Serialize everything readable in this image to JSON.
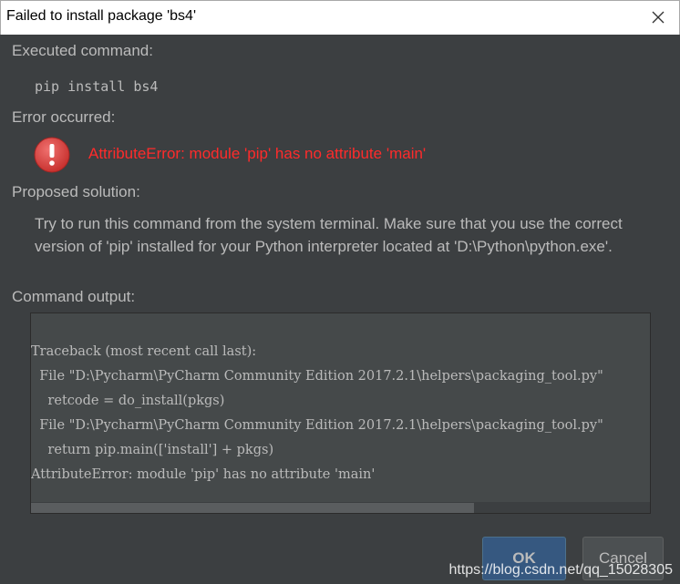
{
  "window": {
    "title": "Failed to install package 'bs4'"
  },
  "sections": {
    "executed_command_label": "Executed command:",
    "command": "pip install bs4",
    "error_occurred_label": "Error occurred:",
    "error_message": "AttributeError: module 'pip' has no attribute 'main'",
    "proposed_solution_label": "Proposed solution:",
    "proposed_solution_text": "Try to run this command from the system terminal. Make sure that you use the correct version of 'pip' installed for your Python interpreter located at 'D:\\Python\\python.exe'.",
    "command_output_label": "Command output:"
  },
  "output_lines": [
    "Traceback (most recent call last):",
    "  File \"D:\\Pycharm\\PyCharm Community Edition 2017.2.1\\helpers\\packaging_tool.py\"",
    "    retcode = do_install(pkgs)",
    "  File \"D:\\Pycharm\\PyCharm Community Edition 2017.2.1\\helpers\\packaging_tool.py\"",
    "    return pip.main(['install'] + pkgs)",
    "AttributeError: module 'pip' has no attribute 'main'"
  ],
  "buttons": {
    "ok": "OK",
    "cancel": "Cancel"
  },
  "watermark": "https://blog.csdn.net/qq_15028305",
  "colors": {
    "dialog_bg": "#3c3f41",
    "error_text": "#ff2b2b",
    "text": "#bbbbbb",
    "ok_button": "#365880"
  },
  "icons": {
    "close": "close-icon",
    "error": "error-icon"
  }
}
